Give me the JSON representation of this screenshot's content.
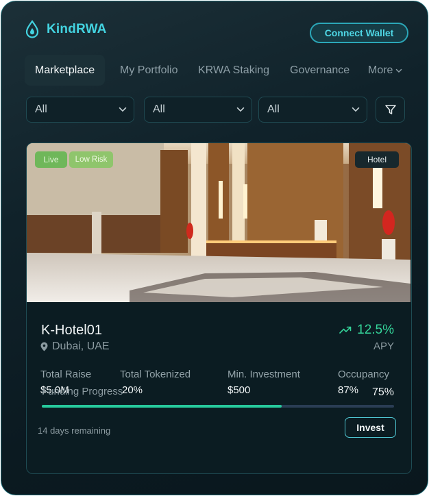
{
  "app": {
    "name": "KindRWA",
    "accent": "#43d3e0"
  },
  "header": {
    "connect_wallet": "Connect Wallet"
  },
  "tabs": [
    {
      "label": "Marketplace",
      "active": true
    },
    {
      "label": "My Portfolio"
    },
    {
      "label": "KRWA Staking"
    },
    {
      "label": "Governance"
    },
    {
      "label": "More"
    }
  ],
  "filters": [
    {
      "selected": "All"
    },
    {
      "selected": "All"
    },
    {
      "selected": "All"
    }
  ],
  "card": {
    "badges": {
      "status": "Live",
      "risk": "Low Risk",
      "type": "Hotel"
    },
    "name": "K-Hotel01",
    "location": "Dubai, UAE",
    "apy": {
      "value": "12.5%",
      "label": "APY",
      "color": "#34d399"
    },
    "stats": [
      {
        "label": "Total Raise",
        "value": "$5.0M"
      },
      {
        "label": "Total Tokenized",
        "value": "20%"
      },
      {
        "label": "Min. Investment",
        "value": "$500"
      },
      {
        "label": "Occupancy",
        "value": "87%"
      }
    ],
    "funding": {
      "label": "Funding Progress",
      "percent_text": "75%",
      "progress": 0.68,
      "fill_color": "#27c99c"
    },
    "remaining": "14 days remaining",
    "invest": "Invest"
  },
  "icons": [
    "drop-logo-icon",
    "chevron-down-icon",
    "filter-icon",
    "map-pin-icon",
    "trending-up-icon"
  ]
}
